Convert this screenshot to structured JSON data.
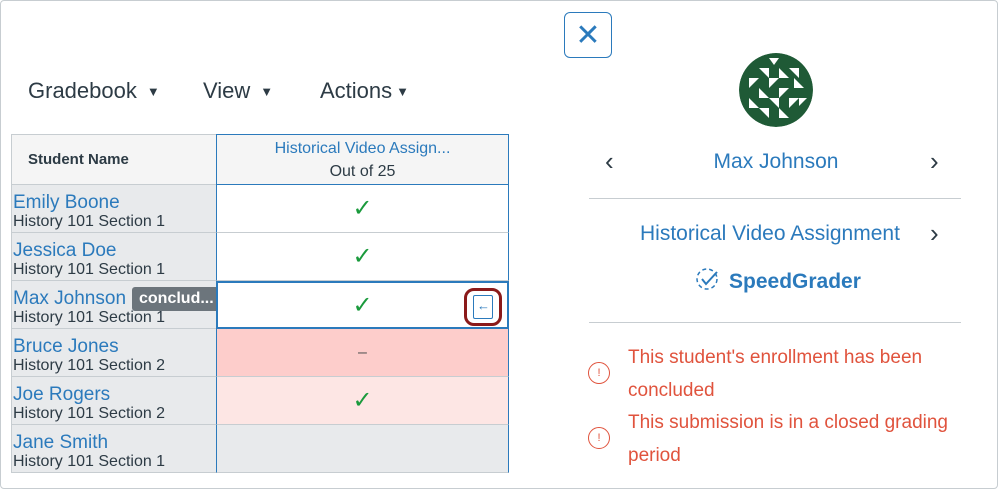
{
  "toolbar": {
    "gradebook_label": "Gradebook",
    "view_label": "View",
    "actions_label": "Actions"
  },
  "grid": {
    "header_name": "Student Name",
    "assignment_title": "Historical Video Assign...",
    "assignment_points": "Out of 25",
    "rows": [
      {
        "name": "Emily Boone",
        "section": "History 101 Section 1",
        "grade": "✓",
        "status": "normal"
      },
      {
        "name": "Jessica Doe",
        "section": "History 101 Section 1",
        "grade": "✓",
        "status": "normal"
      },
      {
        "name": "Max Johnson",
        "section": "History 101 Section 1",
        "grade": "✓",
        "status": "active",
        "badge": "conclud..."
      },
      {
        "name": "Bruce Jones",
        "section": "History 101 Section 2",
        "grade": "–",
        "status": "missing"
      },
      {
        "name": "Joe Rogers",
        "section": "History 101 Section 2",
        "grade": "✓",
        "status": "late"
      },
      {
        "name": "Jane Smith",
        "section": "History 101 Section 1",
        "grade": "",
        "status": "normal"
      }
    ]
  },
  "tray": {
    "student_name": "Max Johnson",
    "assignment_name": "Historical Video Assignment",
    "speedgrader_label": "SpeedGrader",
    "messages": [
      "This student's enrollment has been concluded",
      "This submission is in a closed grading period"
    ]
  },
  "colors": {
    "link": "#2b7abc",
    "warning": "#e0533d",
    "check": "#1a9a3c",
    "missing_bg": "#fdcdcb",
    "late_bg": "#fde6e4",
    "highlight_border": "#8b1a1a"
  },
  "icons": {
    "close": "close-icon",
    "prev": "chevron-left-icon",
    "next": "chevron-right-icon",
    "tray": "open-tray-icon",
    "warning": "warning-icon",
    "speedgrader": "speedgrader-icon"
  }
}
